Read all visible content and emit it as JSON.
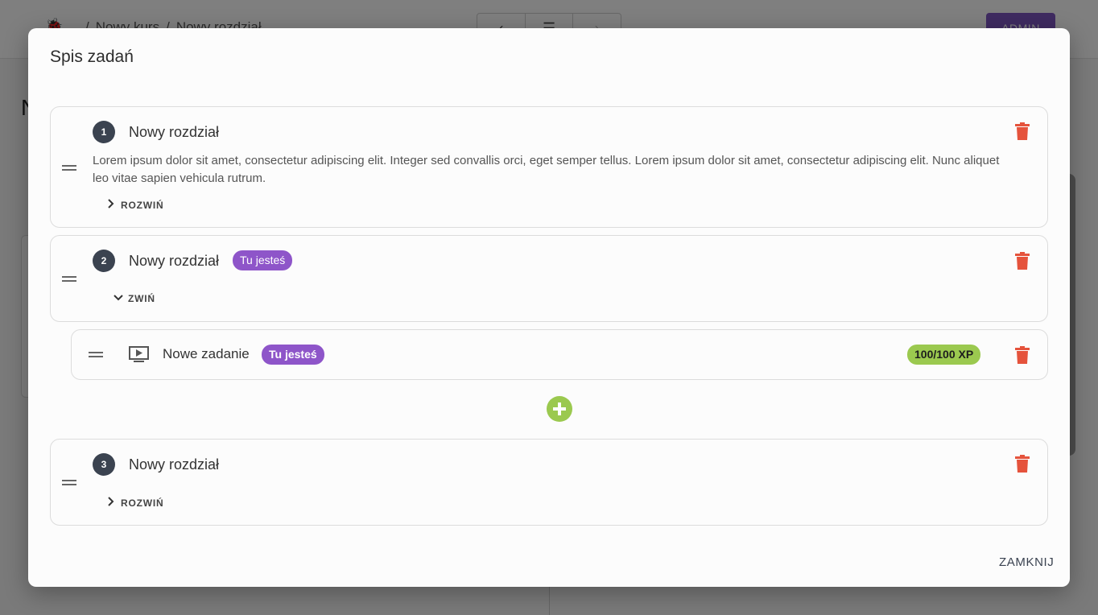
{
  "background": {
    "breadcrumb": [
      "Nowy kurs",
      "Nowy rozdział"
    ],
    "admin_button": "ADMIN",
    "page_heading": "N",
    "nav": {
      "prev": "‹",
      "list": "☰",
      "next": "›"
    }
  },
  "dialog": {
    "title": "Spis zadań",
    "close_label": "ZAMKNIJ",
    "chapters": [
      {
        "number": "1",
        "title": "Nowy rozdział",
        "description": "Lorem ipsum dolor sit amet, consectetur adipiscing elit. Integer sed convallis orci, eget semper tellus. Lorem ipsum dolor sit amet, consectetur adipiscing elit. Nunc aliquet leo vitae sapien vehicula rutrum.",
        "toggle_label": "ROZWIŃ"
      },
      {
        "number": "2",
        "title": "Nowy rozdział",
        "badge": "Tu jesteś",
        "toggle_label": "ZWIŃ",
        "tasks": [
          {
            "title": "Nowe zadanie",
            "badge": "Tu jesteś",
            "xp": "100/100 XP",
            "icon": "video-play-icon"
          }
        ]
      },
      {
        "number": "3",
        "title": "Nowy rozdział",
        "toggle_label": "ROZWIŃ"
      }
    ]
  },
  "colors": {
    "accent_purple": "#8e55c9",
    "xp_green": "#9bc94f",
    "delete_red": "#e5533c",
    "number_badge": "#3b4350"
  }
}
